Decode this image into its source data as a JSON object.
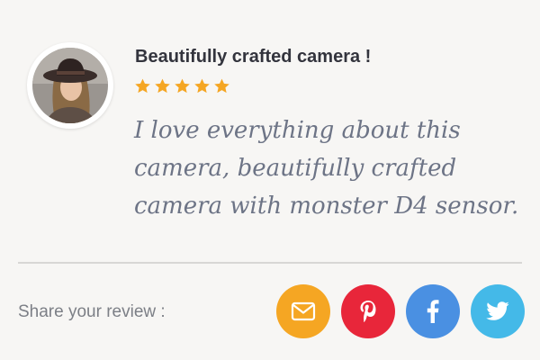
{
  "review": {
    "title": "Beautifully crafted camera !",
    "rating": 5,
    "rating_max": 5,
    "star_color": "#f5a623",
    "text": "I love everything about this camera, beautifully crafted camera with monster D4 sensor."
  },
  "share": {
    "label": "Share your review :",
    "buttons": [
      {
        "name": "email",
        "icon": "envelope-icon",
        "color": "#f5a623"
      },
      {
        "name": "pinterest",
        "icon": "pinterest-icon",
        "color": "#e8263a"
      },
      {
        "name": "facebook",
        "icon": "facebook-icon",
        "color": "#4a90e2"
      },
      {
        "name": "twitter",
        "icon": "twitter-icon",
        "color": "#44b9e8"
      }
    ]
  }
}
